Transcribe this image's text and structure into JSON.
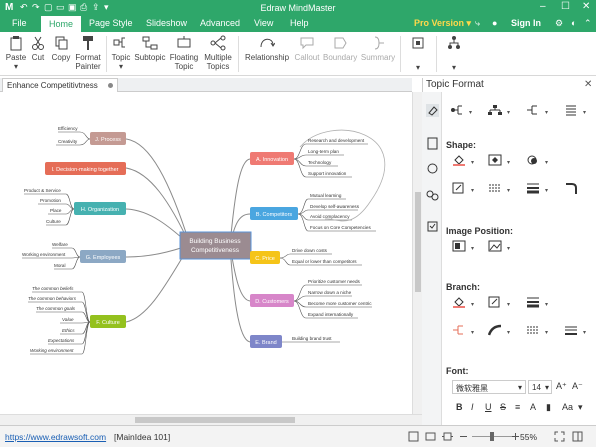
{
  "app": {
    "logo": "M",
    "title": "Edraw MindMaster"
  },
  "menu": {
    "tabs": [
      "File",
      "Home",
      "Page Style",
      "Slideshow",
      "Advanced",
      "View",
      "Help"
    ],
    "active": "Home",
    "pro_label": "Pro Version",
    "signin_label": "Sign In"
  },
  "ribbon": {
    "paste": "Paste",
    "cut": "Cut",
    "copy": "Copy",
    "format_painter_1": "Format",
    "format_painter_2": "Painter",
    "topic": "Topic",
    "subtopic": "Subtopic",
    "floating_1": "Floating",
    "floating_2": "Topic",
    "multiple_1": "Multiple",
    "multiple_2": "Topics",
    "relationship": "Relationship",
    "callout": "Callout",
    "boundary": "Boundary",
    "summary": "Summary"
  },
  "document": {
    "tab_label": "Enhance Competitivtness"
  },
  "mindmap": {
    "central": {
      "line1": "Building Business",
      "line2": "Competitiveness"
    },
    "topics": {
      "process": "J. Process",
      "decision": "I. Decision-making together",
      "organization": "H. Organization",
      "employees": "G. Employees",
      "culture": "F. Culture",
      "innovation": "A. Innovation",
      "competitors": "B. Competitors",
      "price": "C. Price",
      "customers": "D. Customers",
      "brand": "E. Brand"
    },
    "subs": {
      "process": [
        "Efficiency",
        "Creativity"
      ],
      "organization": [
        "Product & Service",
        "Promotion",
        "Place",
        "Culture"
      ],
      "employees": [
        "Welfare",
        "Working environment",
        "Moral"
      ],
      "culture": [
        "The common beliefs",
        "The common behaviors",
        "The common goals",
        "Value",
        "Ethics",
        "Expectations",
        "Working environment"
      ],
      "innovation": [
        "Research and development",
        "Long-term plan",
        "Technology",
        "Support innovation"
      ],
      "competitors": [
        "Mutual learning",
        "Develop self-awareness",
        "Avoid complacency",
        "Focus on Core Competencies"
      ],
      "price": [
        "Drive down costs",
        "Equal or lower than competitors"
      ],
      "customers": [
        "Prioritize customer needs",
        "Narrow down a niche",
        "Become more customer centric",
        "Expand internationally"
      ],
      "brand": [
        "Building brand trust"
      ]
    }
  },
  "panel": {
    "title": "Topic Format",
    "shape_label": "Shape:",
    "image_position_label": "Image Position:",
    "branch_label": "Branch:",
    "font_label": "Font:",
    "font_name": "微软雅黑",
    "font_size": "14"
  },
  "status": {
    "link": "https://www.edrawsoft.com",
    "idea": "[MainIdea 101]",
    "zoom": "55%"
  },
  "colors": {
    "brand_green": "#2ea76a",
    "process": "#c49a93",
    "decision": "#e56d57",
    "organization": "#46b1b0",
    "employees": "#8ca8c4",
    "culture": "#94c11e",
    "innovation": "#ef7a73",
    "competitors": "#4aa6e0",
    "price": "#f5c419",
    "customers": "#d786c9",
    "brand": "#7e86c9",
    "central": "#9b8b91"
  }
}
